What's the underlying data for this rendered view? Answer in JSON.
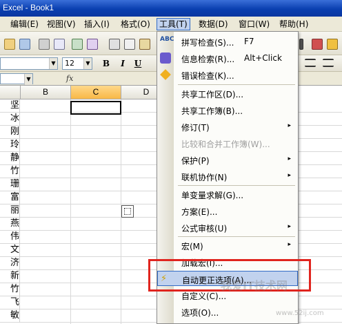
{
  "window": {
    "title": "Excel - Book1"
  },
  "menubar": {
    "items": [
      {
        "label": "编辑(E)"
      },
      {
        "label": "视图(V)"
      },
      {
        "label": "插入(I)"
      },
      {
        "label": "格式(O)"
      },
      {
        "label": "工具(T)"
      },
      {
        "label": "数据(D)"
      },
      {
        "label": "窗口(W)"
      },
      {
        "label": "帮助(H)"
      }
    ]
  },
  "formatting": {
    "font_size": "12",
    "bold": "B",
    "italic": "I",
    "underline": "U"
  },
  "formula_bar": {
    "fx": "fx"
  },
  "columns": [
    "B",
    "C",
    "D"
  ],
  "column_a_cells": [
    "坚",
    "冰",
    "刚",
    "玲",
    "静",
    "竹",
    "珊",
    "富",
    "丽",
    "燕",
    "伟",
    "文",
    "济",
    "新",
    "竹",
    "飞",
    "敏"
  ],
  "tools_menu": {
    "items": [
      {
        "label": "拼写检查(S)...",
        "shortcut": "F7",
        "icon": "spellcheck-icon"
      },
      {
        "label": "信息检索(R)...",
        "shortcut": "Alt+Click",
        "icon": "research-icon"
      },
      {
        "label": "错误检查(K)...",
        "shortcut": "",
        "icon": "error-check-icon"
      },
      {
        "label": "共享工作区(D)...",
        "shortcut": ""
      },
      {
        "label": "共享工作簿(B)...",
        "shortcut": ""
      },
      {
        "label": "修订(T)",
        "submenu": "▸"
      },
      {
        "label": "比较和合并工作簿(W)...",
        "shortcut": "",
        "disabled": true
      },
      {
        "label": "保护(P)",
        "submenu": "▸"
      },
      {
        "label": "联机协作(N)",
        "submenu": "▸"
      },
      {
        "label": "单变量求解(G)...",
        "shortcut": ""
      },
      {
        "label": "方案(E)...",
        "shortcut": ""
      },
      {
        "label": "公式审核(U)",
        "submenu": "▸"
      },
      {
        "label": "宏(M)",
        "submenu": "▸"
      },
      {
        "label": "加载宏(I)...",
        "shortcut": ""
      },
      {
        "label": "自动更正选项(A)...",
        "shortcut": "",
        "icon": "autocorrect-icon"
      },
      {
        "label": "自定义(C)...",
        "shortcut": ""
      },
      {
        "label": "选项(O)...",
        "shortcut": ""
      }
    ]
  },
  "watermark": {
    "text": "我爱IT技术网",
    "url": "www.52ij.com"
  },
  "colors": {
    "titlebar": "#0a3fb0",
    "menu_highlight": "#c1d2ee",
    "annotation": "#e0241e"
  }
}
